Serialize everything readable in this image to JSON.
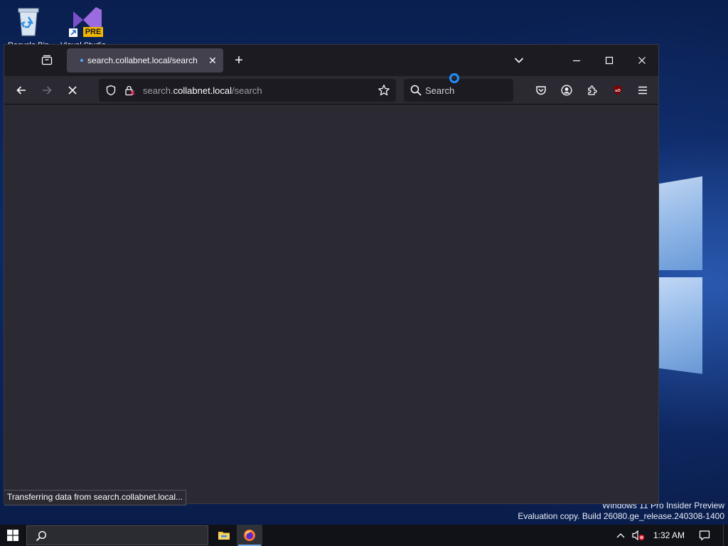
{
  "desktop": {
    "icons": [
      {
        "label": "Recycle Bin"
      },
      {
        "label": "Visual Studio",
        "badge": "PRE"
      }
    ],
    "watermark": {
      "line1": "Windows 11 Pro Insider Preview",
      "line2": "Evaluation copy. Build 26080.ge_release.240308-1400"
    }
  },
  "browser": {
    "tab": {
      "title": "search.collabnet.local/search",
      "close_glyph": "✕"
    },
    "new_tab_glyph": "+",
    "url": {
      "prefix": "search.",
      "host": "collabnet.local",
      "path": "/search"
    },
    "search_placeholder": "Search",
    "status": "Transferring data from search.collabnet.local...",
    "icons": [
      "tab-list-icon",
      "back-arrow-icon",
      "forward-arrow-icon",
      "stop-icon",
      "shield-icon",
      "lock-icon",
      "star-icon",
      "search-icon",
      "pocket-icon",
      "account-icon",
      "extensions-icon",
      "ublock-icon",
      "hamburger-menu-icon"
    ]
  },
  "taskbar": {
    "clock": "1:32 AM",
    "apps": [
      "file-explorer",
      "firefox"
    ],
    "accent": "#7aa7e8"
  },
  "colors": {
    "toolbar": "#2b2a33",
    "titlebar": "#1c1b22",
    "tab": "#42414d",
    "busy_cursor": "#1e90ff"
  }
}
